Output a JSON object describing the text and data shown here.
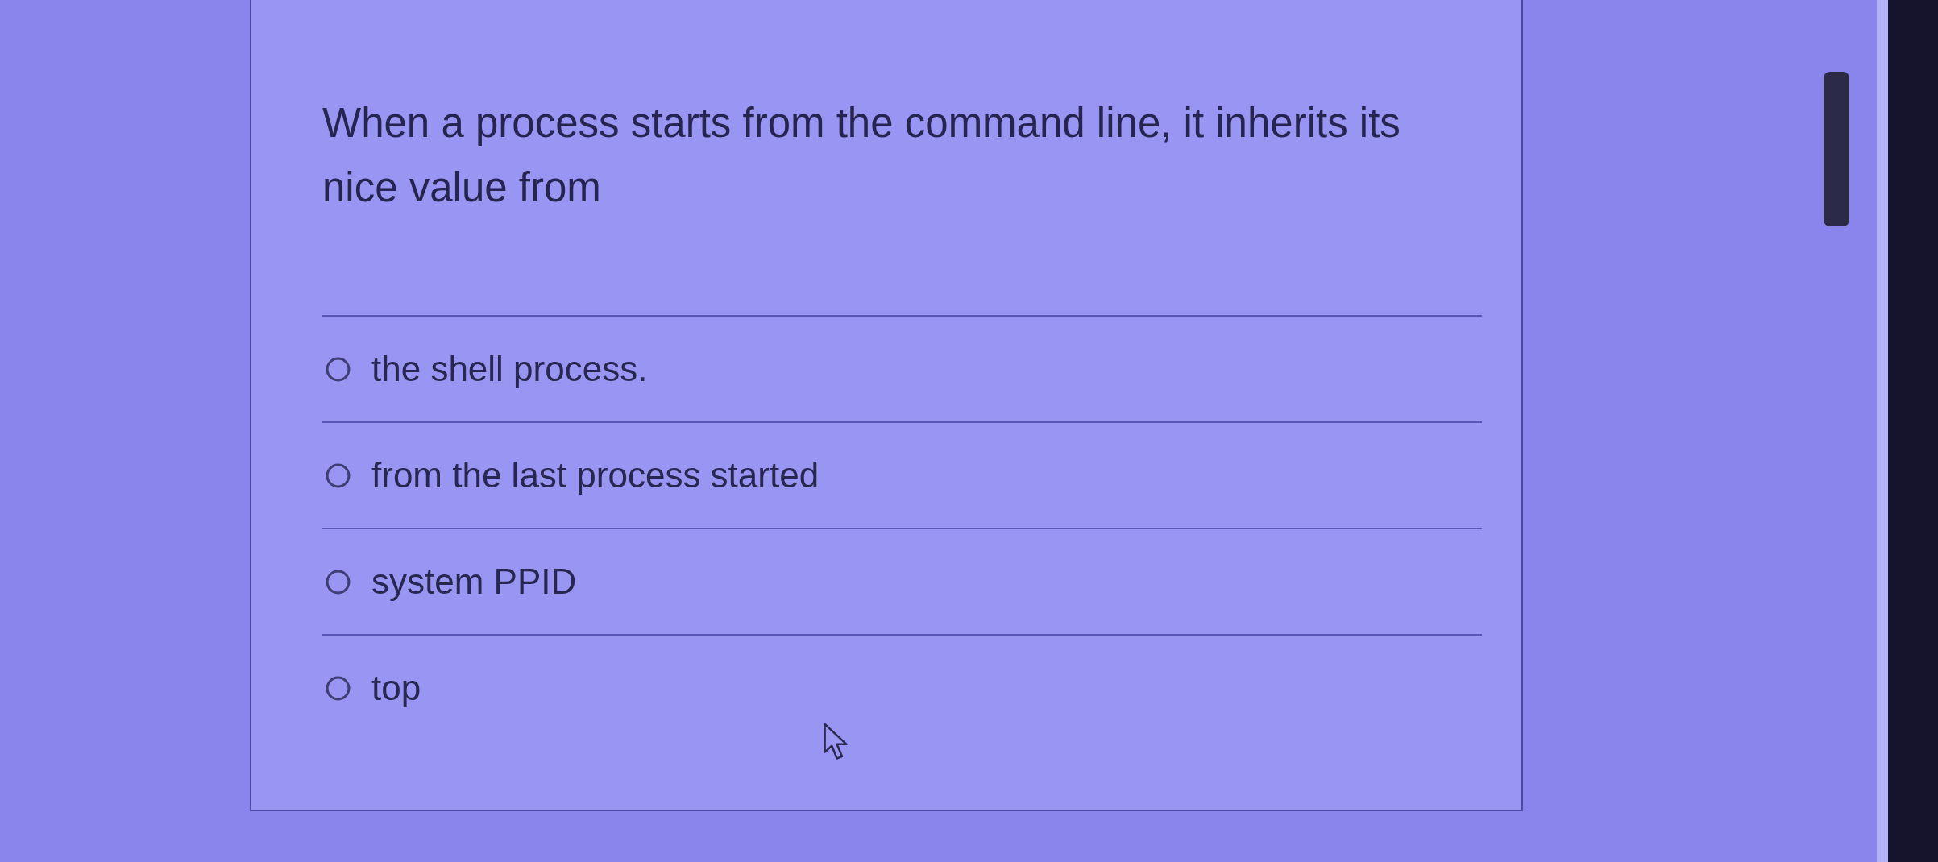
{
  "question": {
    "text": "When a process starts from the command line, it inherits its nice value from"
  },
  "options": [
    {
      "label": "the shell process.",
      "selected": false
    },
    {
      "label": "from the last process started",
      "selected": false
    },
    {
      "label": "system PPID",
      "selected": false
    },
    {
      "label": "top",
      "selected": false
    }
  ]
}
